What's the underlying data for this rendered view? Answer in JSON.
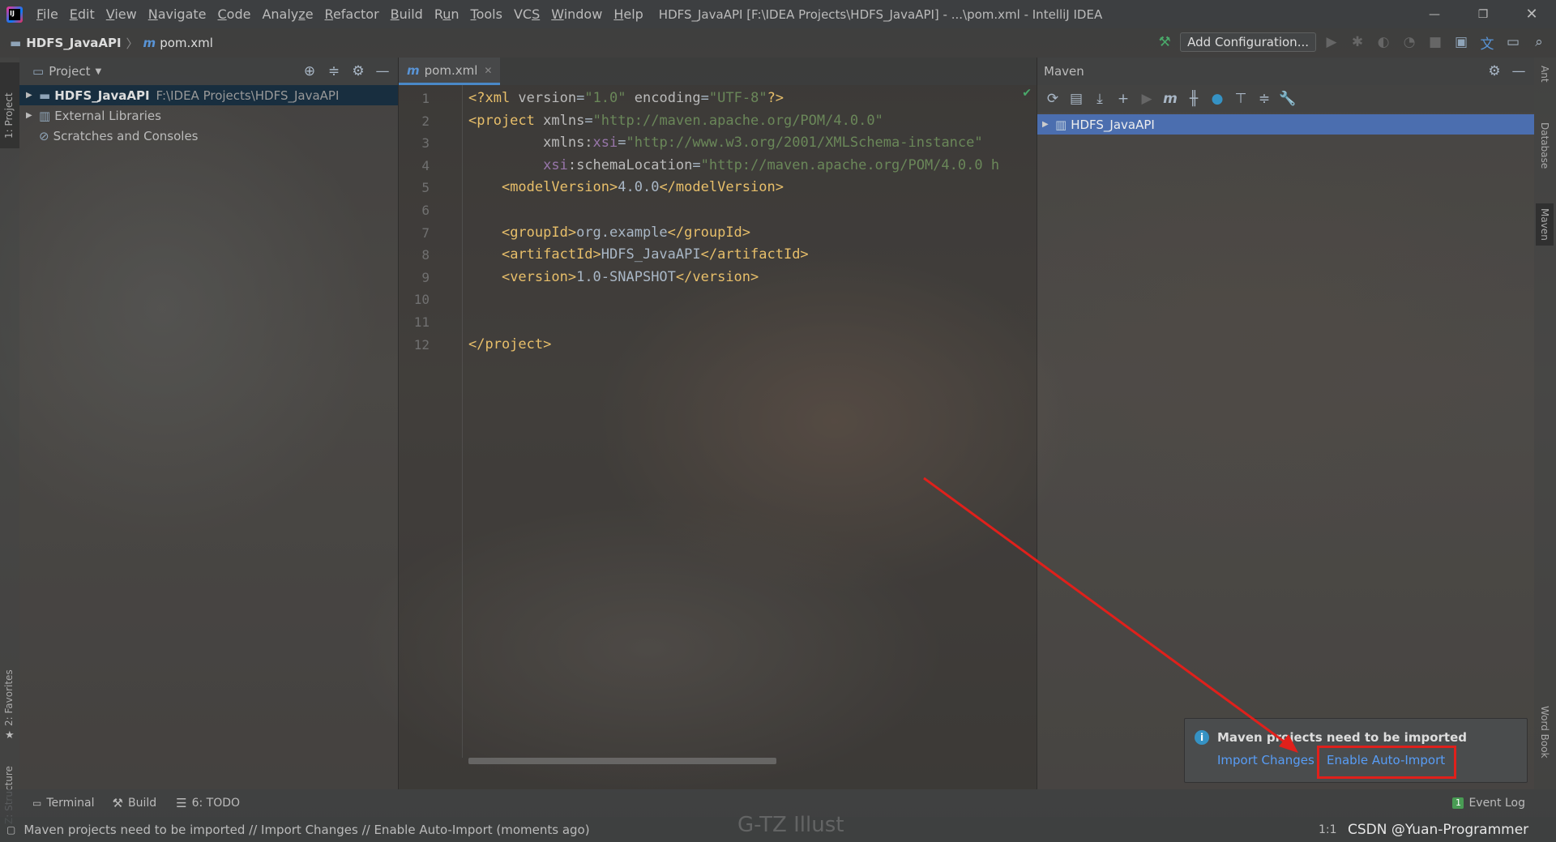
{
  "window": {
    "title": "HDFS_JavaAPI [F:\\IDEA Projects\\HDFS_JavaAPI] - ...\\pom.xml - IntelliJ IDEA",
    "logo_text": "IJ"
  },
  "menu": [
    {
      "label": "File",
      "u": "F"
    },
    {
      "label": "Edit",
      "u": "E"
    },
    {
      "label": "View",
      "u": "V"
    },
    {
      "label": "Navigate",
      "u": "N"
    },
    {
      "label": "Code",
      "u": "C"
    },
    {
      "label": "Analyze",
      "u": "z"
    },
    {
      "label": "Refactor",
      "u": "R"
    },
    {
      "label": "Build",
      "u": "B"
    },
    {
      "label": "Run",
      "u": "u"
    },
    {
      "label": "Tools",
      "u": "T"
    },
    {
      "label": "VCS",
      "u": "S"
    },
    {
      "label": "Window",
      "u": "W"
    },
    {
      "label": "Help",
      "u": "H"
    }
  ],
  "breadcrumb": {
    "project": "HDFS_JavaAPI",
    "file": "pom.xml"
  },
  "toolbar": {
    "add_configuration": "Add Configuration..."
  },
  "project_panel": {
    "title": "Project",
    "tree": [
      {
        "label": "HDFS_JavaAPI",
        "path": "F:\\IDEA Projects\\HDFS_JavaAPI"
      },
      {
        "label": "External Libraries"
      },
      {
        "label": "Scratches and Consoles"
      }
    ]
  },
  "editor": {
    "tab": "pom.xml",
    "line_numbers": [
      "1",
      "2",
      "3",
      "4",
      "5",
      "6",
      "7",
      "8",
      "9",
      "10",
      "11",
      "12"
    ]
  },
  "maven_panel": {
    "title": "Maven",
    "project": "HDFS_JavaAPI"
  },
  "side_tabs": {
    "project": "1: Project",
    "favorites": "2: Favorites",
    "structure": "Z: Structure",
    "ant": "Ant",
    "database": "Database",
    "maven": "Maven",
    "word_book": "Word Book"
  },
  "notification": {
    "title": "Maven projects need to be imported",
    "import_changes": "Import Changes",
    "enable_auto_import": "Enable Auto-Import"
  },
  "bottom_tabs": {
    "terminal": "Terminal",
    "build": "Build",
    "todo": "6: TODO",
    "event_log": "Event Log",
    "event_count": "1"
  },
  "status": {
    "message": "Maven projects need to be imported // Import Changes // Enable Auto-Import (moments ago)",
    "position": "1:1",
    "watermark": "CSDN @Yuan-Programmer",
    "bg_watermark": "G-TZ Illust"
  },
  "colors": {
    "accent": "#4b6eaf",
    "link": "#589df6",
    "highlight_box": "#e0201b"
  }
}
